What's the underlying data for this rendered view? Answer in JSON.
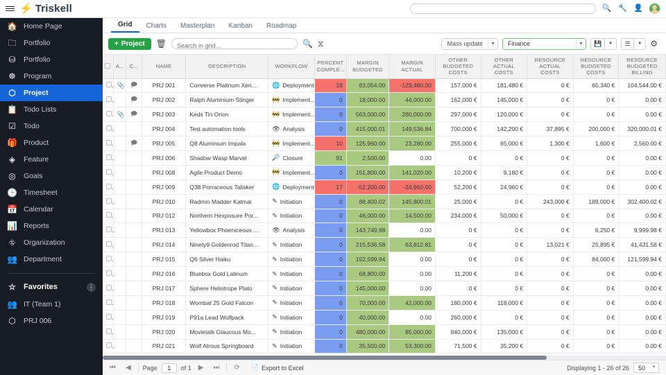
{
  "topbar": {
    "menu_icon": "hamburger-icon",
    "brand_mark": "⚡",
    "brand_name": "Triskell",
    "search_placeholder": "",
    "icons": [
      {
        "name": "search-icon",
        "glyph": "🔍"
      },
      {
        "name": "wrench-icon",
        "glyph": "🔧"
      },
      {
        "name": "user-add-icon",
        "glyph": "👤"
      }
    ],
    "avatar_label": "avatar"
  },
  "sidebar": {
    "items": [
      {
        "label": "Home Page",
        "icon": "home-icon",
        "glyph": "🏠",
        "active": false
      },
      {
        "label": "Portfolio",
        "icon": "folder-icon",
        "glyph": "🗀",
        "active": false
      },
      {
        "label": "Portfolio",
        "icon": "sitemap-icon",
        "glyph": "⛁",
        "active": false
      },
      {
        "label": "Program",
        "icon": "hierarchy-icon",
        "glyph": "☸",
        "active": false
      },
      {
        "label": "Project",
        "icon": "cube-icon",
        "glyph": "⬡",
        "active": true
      },
      {
        "label": "Todo Lists",
        "icon": "clipboard-icon",
        "glyph": "📋",
        "active": false
      },
      {
        "label": "Todo",
        "icon": "checkbox-icon",
        "glyph": "☑",
        "active": false
      },
      {
        "label": "Product",
        "icon": "product-icon",
        "glyph": "🎁",
        "active": false
      },
      {
        "label": "Feature",
        "icon": "feature-icon",
        "glyph": "◈",
        "active": false
      },
      {
        "label": "Goals",
        "icon": "target-icon",
        "glyph": "◎",
        "active": false
      },
      {
        "label": "Timesheet",
        "icon": "clock-icon",
        "glyph": "🕒",
        "active": false
      },
      {
        "label": "Calendar",
        "icon": "calendar-icon",
        "glyph": "📅",
        "active": false
      },
      {
        "label": "Reports",
        "icon": "chart-icon",
        "glyph": "📊",
        "active": false
      },
      {
        "label": "Organization",
        "icon": "org-chart-icon",
        "glyph": "⛗",
        "active": false
      },
      {
        "label": "Department",
        "icon": "people-icon",
        "glyph": "👥",
        "active": false
      }
    ],
    "favorites": {
      "title": "Favorites",
      "icon": "star-icon",
      "glyph": "☆",
      "menu_glyph": "⋮",
      "items": [
        {
          "label": "IT (Team 1)",
          "icon": "people-icon",
          "glyph": "👥"
        },
        {
          "label": "PRJ 006",
          "icon": "cube-icon",
          "glyph": "⬡"
        }
      ]
    }
  },
  "tabs": [
    {
      "label": "Grid",
      "active": true
    },
    {
      "label": "Charts",
      "active": false
    },
    {
      "label": "Masterplan",
      "active": false
    },
    {
      "label": "Kanban",
      "active": false
    },
    {
      "label": "Roadmap",
      "active": false
    }
  ],
  "toolbar": {
    "project_button": "Project",
    "project_plus": "+",
    "delete_icon_glyph": "🗑",
    "search_placeholder": "Search in grid...",
    "search_value": "",
    "search_icon_glyph": "🔍",
    "filter_icon_glyph": "⧖",
    "mass_update_label": "Mass update",
    "view_value": "Finance",
    "save_icon_glyph": "💾",
    "list_icon_glyph": "☰",
    "gear_icon_glyph": "⚙",
    "arrow_glyph": "▼"
  },
  "grid": {
    "columns": [
      "A...",
      "C...",
      "NAME",
      "DESCRIPTION",
      "WORKFLOW",
      "PERCENT COMPLE...",
      "MARGIN BUDGETED",
      "MARGIN ACTUAL",
      "OTHER BUDGETED COSTS",
      "OTHER ACTUAL COSTS",
      "RESOURCE ACTUAL COSTS",
      "RESOURCE BUDGETED COSTS",
      "RESOURCE BUDGETED BILLING"
    ],
    "rows": [
      {
        "attach": true,
        "comment": true,
        "name": "PRJ 001",
        "desc": "Converse Platinum Xen...",
        "wf": "Deployment",
        "wf_icon": "globe-icon",
        "wf_glyph": "🌐",
        "pct": "18",
        "pct_color": "red",
        "mb": "83,054.00",
        "mb_color": "green",
        "ma": "-129,480.00",
        "ma_color": "red",
        "obc": "157,000 €",
        "oac": "181,480 €",
        "rac": "0 €",
        "rbc": "65,340 €",
        "rbb": "104,544.00 €"
      },
      {
        "attach": false,
        "comment": true,
        "name": "PRJ 002",
        "desc": "Ralph Aluminium Stinger",
        "wf": "Implement...",
        "wf_icon": "cone-icon",
        "wf_glyph": "🚧",
        "pct": "0",
        "pct_color": "blue",
        "mb": "18,000.00",
        "mb_color": "green",
        "ma": "44,000.00",
        "ma_color": "green",
        "obc": "162,000 €",
        "oac": "145,000 €",
        "rac": "0 €",
        "rbc": "0 €",
        "rbb": "0.00 €"
      },
      {
        "attach": true,
        "comment": true,
        "name": "PRJ 003",
        "desc": "Keds Tin Orion",
        "wf": "Implement...",
        "wf_icon": "cone-icon",
        "wf_glyph": "🚧",
        "pct": "0",
        "pct_color": "blue",
        "mb": "563,000.00",
        "mb_color": "green",
        "ma": "280,000.00",
        "ma_color": "green",
        "obc": "297,000 €",
        "oac": "120,000 €",
        "rac": "0 €",
        "rbc": "0 €",
        "rbb": "0.00 €"
      },
      {
        "attach": false,
        "comment": false,
        "name": "PRJ 004",
        "desc": "Test automation tools",
        "wf": "Analysis",
        "wf_icon": "eye-icon",
        "wf_glyph": "👁",
        "pct": "0",
        "pct_color": "blue",
        "mb": "415,000.01",
        "mb_color": "green",
        "ma": "149,536.84",
        "ma_color": "green",
        "obc": "700,000 €",
        "oac": "142,200 €",
        "rac": "37,895 €",
        "rbc": "200,000 €",
        "rbb": "320,000.01 €"
      },
      {
        "attach": false,
        "comment": true,
        "name": "PRJ 005",
        "desc": "Q8 Aluminium Impala",
        "wf": "Implement...",
        "wf_icon": "cone-icon",
        "wf_glyph": "🚧",
        "pct": "10",
        "pct_color": "red",
        "mb": "125,960.00",
        "mb_color": "green",
        "ma": "23,280.00",
        "ma_color": "green",
        "obc": "255,000 €",
        "oac": "65,000 €",
        "rac": "1,300 €",
        "rbc": "1,600 €",
        "rbb": "2,560.00 €"
      },
      {
        "attach": false,
        "comment": false,
        "name": "PRJ 006",
        "desc": "Shadow Wasp Marvel",
        "wf": "Closure",
        "wf_icon": "magnifier-check-icon",
        "wf_glyph": "🔎",
        "pct": "91",
        "pct_color": "green",
        "mb": "2,500.00",
        "mb_color": "green",
        "ma": "0.00",
        "ma_color": "plain",
        "obc": "0 €",
        "oac": "0 €",
        "rac": "0 €",
        "rbc": "0 €",
        "rbb": "0.00 €"
      },
      {
        "attach": false,
        "comment": false,
        "name": "PRJ 008",
        "desc": "Agile Product Demo",
        "wf": "Implement...",
        "wf_icon": "cone-icon",
        "wf_glyph": "🚧",
        "pct": "0",
        "pct_color": "blue",
        "mb": "151,800.00",
        "mb_color": "green",
        "ma": "141,020.00",
        "ma_color": "green",
        "obc": "10,200 €",
        "oac": "9,180 €",
        "rac": "0 €",
        "rbc": "0 €",
        "rbb": "0.00 €"
      },
      {
        "attach": false,
        "comment": false,
        "name": "PRJ 009",
        "desc": "Q38 Porraceous Talisker",
        "wf": "Deployment",
        "wf_icon": "globe-icon",
        "wf_glyph": "🌐",
        "pct": "17",
        "pct_color": "red",
        "mb": "-52,200.00",
        "mb_color": "red",
        "ma": "-24,960.00",
        "ma_color": "red",
        "obc": "52,200 €",
        "oac": "24,960 €",
        "rac": "0 €",
        "rbc": "0 €",
        "rbb": "0.00 €"
      },
      {
        "attach": false,
        "comment": false,
        "name": "PRJ 010",
        "desc": "Radmin Madder Katmai",
        "wf": "Initiation",
        "wf_icon": "pencil-icon",
        "wf_glyph": "✎",
        "pct": "0",
        "pct_color": "blue",
        "mb": "88,400.02",
        "mb_color": "green",
        "ma": "145,800.01",
        "ma_color": "green",
        "obc": "25,000 €",
        "oac": "0 €",
        "rac": "243,000 €",
        "rbc": "189,000 €",
        "rbb": "302,400.02 €"
      },
      {
        "attach": false,
        "comment": false,
        "name": "PRJ 012",
        "desc": "Northern Hexposure Por...",
        "wf": "Initiation",
        "wf_icon": "pencil-icon",
        "wf_glyph": "✎",
        "pct": "0",
        "pct_color": "blue",
        "mb": "46,000.00",
        "mb_color": "green",
        "ma": "14,500.00",
        "ma_color": "green",
        "obc": "234,000 €",
        "oac": "50,000 €",
        "rac": "0 €",
        "rbc": "0 €",
        "rbb": "0.00 €"
      },
      {
        "attach": false,
        "comment": false,
        "name": "PRJ 013",
        "desc": "Yellowbox Phoeniceous ...",
        "wf": "Analysis",
        "wf_icon": "eye-icon",
        "wf_glyph": "👁",
        "pct": "0",
        "pct_color": "blue",
        "mb": "143,749.98",
        "mb_color": "green",
        "ma": "0.00",
        "ma_color": "plain",
        "obc": "0 €",
        "oac": "0 €",
        "rac": "0 €",
        "rbc": "6,250 €",
        "rbb": "9,999.98 €"
      },
      {
        "attach": false,
        "comment": false,
        "name": "PRJ 014",
        "desc": "Ninety9 Goldenrod Titan...",
        "wf": "Initiation",
        "wf_icon": "pencil-icon",
        "wf_glyph": "✎",
        "pct": "0",
        "pct_color": "blue",
        "mb": "215,536.58",
        "mb_color": "green",
        "ma": "63,812.81",
        "ma_color": "green",
        "obc": "0 €",
        "oac": "0 €",
        "rac": "13,021 €",
        "rbc": "25,895 €",
        "rbb": "41,431.58 €"
      },
      {
        "attach": false,
        "comment": false,
        "name": "PRJ 015",
        "desc": "Q6 Silver Haiku",
        "wf": "Initiation",
        "wf_icon": "pencil-icon",
        "wf_glyph": "✎",
        "pct": "0",
        "pct_color": "blue",
        "mb": "152,599.94",
        "mb_color": "green",
        "ma": "0.00",
        "ma_color": "plain",
        "obc": "0 €",
        "oac": "0 €",
        "rac": "0 €",
        "rbc": "84,000 €",
        "rbb": "121,599.94 €"
      },
      {
        "attach": false,
        "comment": false,
        "name": "PRJ 016",
        "desc": "Bluebox Gold Latinum",
        "wf": "Initiation",
        "wf_icon": "pencil-icon",
        "wf_glyph": "✎",
        "pct": "0",
        "pct_color": "blue",
        "mb": "68,800.00",
        "mb_color": "green",
        "ma": "0.00",
        "ma_color": "plain",
        "obc": "11,200 €",
        "oac": "0 €",
        "rac": "0 €",
        "rbc": "0 €",
        "rbb": "0.00 €"
      },
      {
        "attach": false,
        "comment": false,
        "name": "PRJ 017",
        "desc": "Sphere Heliotrope Plato",
        "wf": "Initiation",
        "wf_icon": "pencil-icon",
        "wf_glyph": "✎",
        "pct": "0",
        "pct_color": "blue",
        "mb": "145,000.00",
        "mb_color": "green",
        "ma": "0.00",
        "ma_color": "plain",
        "obc": "0 €",
        "oac": "0 €",
        "rac": "0 €",
        "rbc": "0 €",
        "rbb": "0.00 €"
      },
      {
        "attach": false,
        "comment": false,
        "name": "PRJ 018",
        "desc": "Wombat 25 Gold Falcon",
        "wf": "Initiation",
        "wf_icon": "pencil-icon",
        "wf_glyph": "✎",
        "pct": "0",
        "pct_color": "blue",
        "mb": "70,000.00",
        "mb_color": "green",
        "ma": "42,000.00",
        "ma_color": "green",
        "obc": "180,000 €",
        "oac": "118,000 €",
        "rac": "0 €",
        "rbc": "0 €",
        "rbb": "0.00 €"
      },
      {
        "attach": false,
        "comment": false,
        "name": "PRJ 019",
        "desc": "P91a Lead Wolfpack",
        "wf": "Initiation",
        "wf_icon": "pencil-icon",
        "wf_glyph": "✎",
        "pct": "0",
        "pct_color": "blue",
        "mb": "40,000.00",
        "mb_color": "green",
        "ma": "0.00",
        "ma_color": "plain",
        "obc": "260,000 €",
        "oac": "0 €",
        "rac": "0 €",
        "rbc": "0 €",
        "rbb": "0.00 €"
      },
      {
        "attach": false,
        "comment": false,
        "name": "PRJ 020",
        "desc": "Movietalk Glaucous Mo...",
        "wf": "Initiation",
        "wf_icon": "pencil-icon",
        "wf_glyph": "✎",
        "pct": "0",
        "pct_color": "blue",
        "mb": "480,000.00",
        "mb_color": "green",
        "ma": "85,000.00",
        "ma_color": "green",
        "obc": "840,000 €",
        "oac": "135,000 €",
        "rac": "0 €",
        "rbc": "0 €",
        "rbb": "0.00 €"
      },
      {
        "attach": false,
        "comment": false,
        "name": "PRJ 021",
        "desc": "Wolf Atrous Springboard",
        "wf": "Initiation",
        "wf_icon": "pencil-icon",
        "wf_glyph": "✎",
        "pct": "0",
        "pct_color": "blue",
        "mb": "35,500.00",
        "mb_color": "green",
        "ma": "53,300.00",
        "ma_color": "green",
        "obc": "71,500 €",
        "oac": "35,200 €",
        "rac": "0 €",
        "rbc": "0 €",
        "rbb": "0.00 €"
      }
    ]
  },
  "footer": {
    "first_glyph": "⏮",
    "prev_glyph": "◀",
    "page_label": "Page",
    "page_value": "1",
    "of_label": "of 1",
    "next_glyph": "▶",
    "last_glyph": "⏭",
    "refresh_glyph": "⟳",
    "export_label": "Export to Excel",
    "export_glyph": "📄",
    "displaying": "Displaying 1 - 26 of 26",
    "page_size": "50",
    "page_size_arrow": "▼"
  },
  "colors": {
    "accent_blue": "#1565d8",
    "green": "#25a244",
    "cell_green": "#a8c97f",
    "cell_red": "#f5726a",
    "cell_blue": "#7a9cf0",
    "sidebar_bg": "#171c24"
  }
}
